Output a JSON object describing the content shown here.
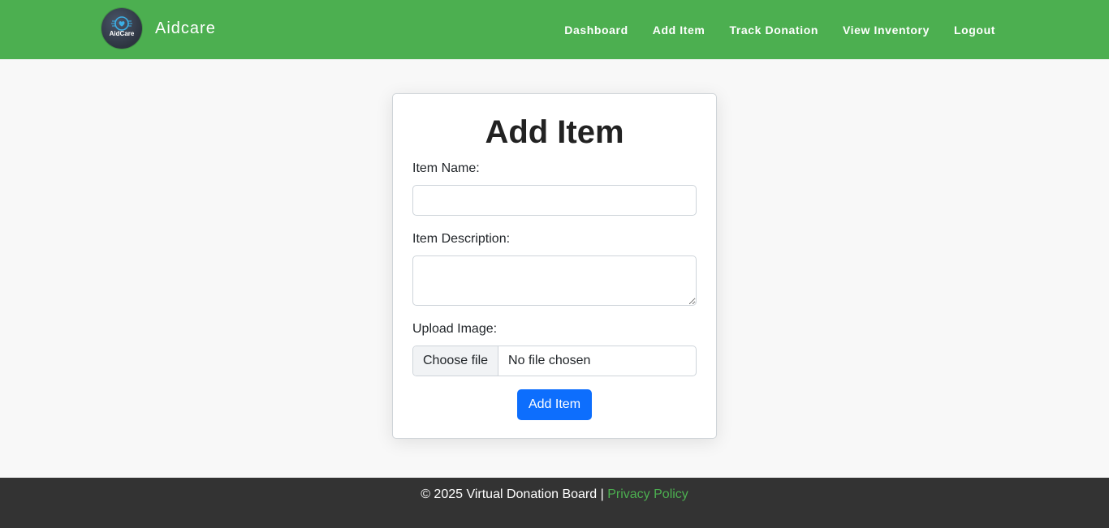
{
  "brand": {
    "name": "Aidcare",
    "logo_text": "AidCare",
    "logo_icon": "heart-hands-icon"
  },
  "nav": {
    "items": [
      {
        "label": "Dashboard"
      },
      {
        "label": "Add Item"
      },
      {
        "label": "Track Donation"
      },
      {
        "label": "View Inventory"
      },
      {
        "label": "Logout"
      }
    ]
  },
  "form": {
    "title": "Add Item",
    "item_name_label": "Item Name:",
    "item_name_value": "",
    "item_description_label": "Item Description:",
    "item_description_value": "",
    "upload_label": "Upload Image:",
    "file_button_label": "Choose file",
    "file_status": "No file chosen",
    "submit_label": "Add Item"
  },
  "footer": {
    "copyright": "© 2025 Virtual Donation Board |",
    "privacy_link": "Privacy Policy"
  },
  "colors": {
    "navbar": "#4caf50",
    "primary_button": "#0d6efd",
    "footer": "#333333",
    "link": "#4caf50",
    "page_background": "#f8f8f8"
  }
}
